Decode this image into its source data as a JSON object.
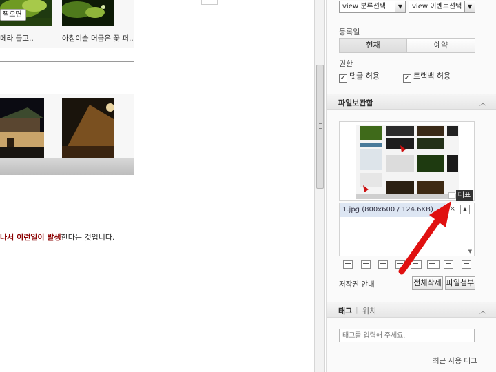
{
  "editor": {
    "camera_button": "찍으면",
    "thumb_captions": [
      "메라 들고..",
      "아침이슬 머금은 꽃 퍼.."
    ],
    "body_text": {
      "highlight": "나서 이런일이 발생",
      "rest": "한다는 것입니다."
    }
  },
  "sidebar": {
    "category_select": "view 분류선택",
    "event_select": "view 이벤트선택",
    "register_label": "등록일",
    "register_options": [
      "현재",
      "예약"
    ],
    "permission_label": "권한",
    "permissions": [
      {
        "label": "댓글 허용",
        "checked": true
      },
      {
        "label": "트랙백 허용",
        "checked": true
      }
    ],
    "file_section": {
      "title": "파일보관함",
      "representative_label": "대표",
      "file_entry": "1.jpg (800x600 / 124.6KB)",
      "delete_all": "전체삭제",
      "attach": "파일첨부",
      "copyright": "저작권 안내"
    },
    "tag_section": {
      "title": "태그",
      "location_tab": "위치",
      "placeholder": "태그를 입력해 주세요.",
      "recent_link": "최근 사용 태그"
    }
  },
  "colors": {
    "highlight_text": "#8b0000",
    "annotation_arrow": "#e01010",
    "file_row_bg": "#dde6f3"
  }
}
